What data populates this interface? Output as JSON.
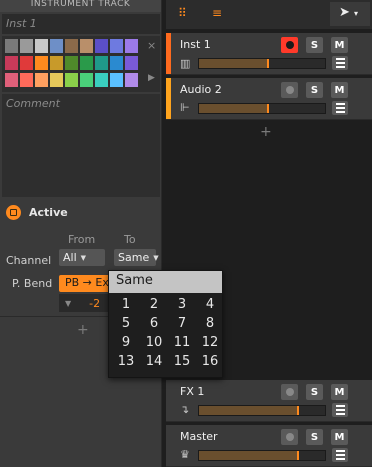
{
  "inspector": {
    "header": "INSTRUMENT TRACK",
    "name_placeholder": "Inst 1",
    "comment_placeholder": "Comment",
    "palette_close": "×",
    "palette_next": "▶",
    "palette_colors": [
      [
        "#7a7a7a",
        "#9a9a9a",
        "#c8c8c8",
        "#6e8fc7",
        "#8b6a4a",
        "#b98f6a",
        "#5b4fc7",
        "#6e7ae0",
        "#9c7ae8"
      ],
      [
        "#c83a5a",
        "#e03a3a",
        "#ff8a1e",
        "#c89a2a",
        "#4f8a2a",
        "#2a9a4a",
        "#1f9a8a",
        "#2a8ad0",
        "#7a5ad8"
      ],
      [
        "#e0607a",
        "#ff6a5a",
        "#ffa060",
        "#e6c85a",
        "#8ad04a",
        "#4ad07a",
        "#3ad0c0",
        "#5ac0ff",
        "#b08ae8"
      ]
    ],
    "active_label": "Active",
    "from_label": "From",
    "to_label": "To",
    "channel_label": "Channel",
    "channel_from": "All",
    "channel_to": "Same",
    "pbend_label": "P. Bend",
    "pbend_value": "PB → Ex",
    "pbend_amount": "-2",
    "add_label": "+"
  },
  "toolbar": {
    "grid_icon": "⠿",
    "list_icon": "≡",
    "pointer_icon": "➤",
    "pointer_caret": "▾"
  },
  "tracks": [
    {
      "name": "Inst 1",
      "stripe": "#ff6a1e",
      "rec_active": true,
      "solo": "S",
      "mute": "M",
      "icon": "keyboard"
    },
    {
      "name": "Audio 2",
      "stripe": "#ffa41e",
      "rec_active": false,
      "solo": "S",
      "mute": "M",
      "icon": "waveform"
    },
    {
      "name": "FX 1",
      "stripe": "#3a3a3a",
      "rec_active": false,
      "solo": "S",
      "mute": "M",
      "icon": "fx-return"
    },
    {
      "name": "Master",
      "stripe": "#3a3a3a",
      "rec_active": false,
      "solo": "S",
      "mute": "M",
      "icon": "crown"
    }
  ],
  "add_track_label": "+",
  "channel_menu": {
    "head": "Same",
    "options": [
      "1",
      "2",
      "3",
      "4",
      "5",
      "6",
      "7",
      "8",
      "9",
      "10",
      "11",
      "12",
      "13",
      "14",
      "15",
      "16"
    ]
  }
}
